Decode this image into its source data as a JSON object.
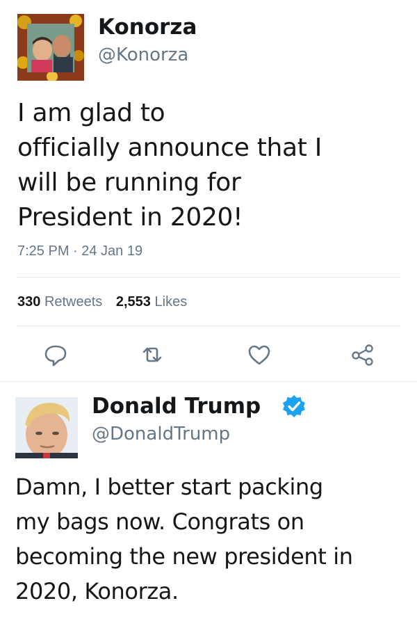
{
  "tweet1": {
    "display_name": "Konorza",
    "handle": "@Konorza",
    "text_lines": [
      "I am glad to",
      "officially announce that I",
      "will be running for",
      "President in 2020!"
    ],
    "timestamp": "7:25 PM · 24 Jan 19",
    "retweets_count": "330",
    "retweets_label": "Retweets",
    "likes_count": "2,553",
    "likes_label": "Likes",
    "actions": [
      "reply-icon",
      "retweet-icon",
      "like-icon",
      "share-icon"
    ]
  },
  "tweet2": {
    "display_name": "Donald Trump",
    "handle": "@DonaldTrump",
    "verified_icon": "verified-badge-icon",
    "text_lines": [
      "Damn, I better start packing",
      "my bags now. Congrats on",
      "becoming the new president in",
      "2020, Konorza."
    ]
  },
  "colors": {
    "text": "#14171a",
    "secondary": "#657786",
    "divider": "#e1e8ed",
    "verified": "#1da1f2"
  }
}
